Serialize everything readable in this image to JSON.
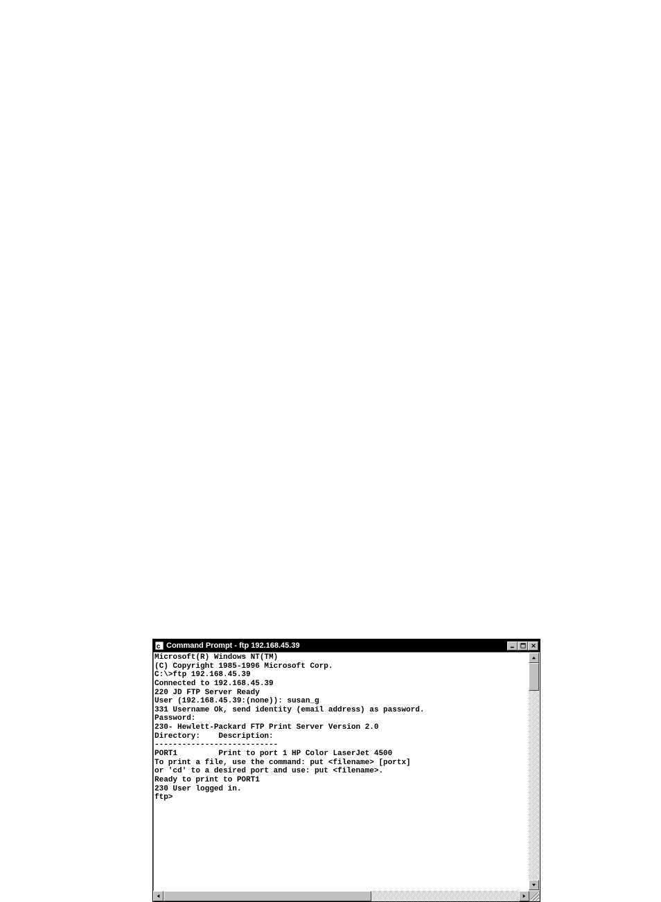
{
  "window": {
    "title": "Command Prompt - ftp 192.168.45.39"
  },
  "terminal": {
    "lines": [
      "Microsoft(R) Windows NT(TM)",
      "(C) Copyright 1985-1996 Microsoft Corp.",
      "",
      "C:\\>ftp 192.168.45.39",
      "Connected to 192.168.45.39",
      "220 JD FTP Server Ready",
      "User (192.168.45.39:(none)): susan_g",
      "331 Username Ok, send identity (email address) as password.",
      "Password:",
      "230- Hewlett-Packard FTP Print Server Version 2.0",
      "Directory:    Description:",
      "---------------------------",
      "PORT1         Print to port 1 HP Color LaserJet 4500",
      "",
      "To print a file, use the command: put <filename> [portx]",
      "or 'cd' to a desired port and use: put <filename>.",
      "",
      "Ready to print to PORT1",
      "",
      "230 User logged in.",
      "ftp>"
    ]
  }
}
